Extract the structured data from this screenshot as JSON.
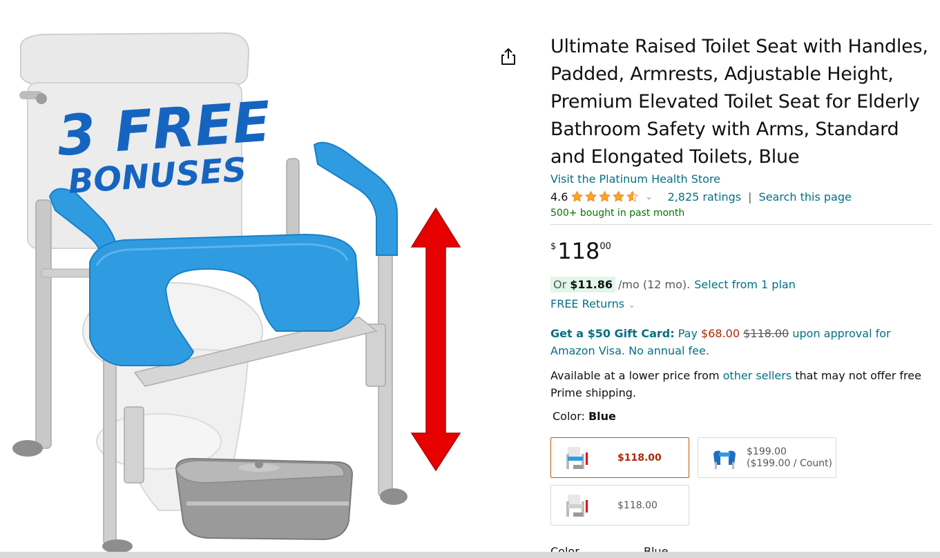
{
  "product": {
    "title": "Ultimate Raised Toilet Seat with Handles, Padded, Armrests, Adjustable Height, Premium Elevated Toilet Seat for Elderly Bathroom Safety with Arms, Standard and Elongated Toilets, Blue",
    "image_text_line1": "3 FREE",
    "image_text_line2": "BONUSES"
  },
  "store": {
    "link_text": "Visit the Platinum Health Store"
  },
  "rating": {
    "value": "4.6",
    "stars": 4.6,
    "ratings_count": "2,825 ratings",
    "separator": "|",
    "search_link": "Search this page"
  },
  "bought_text": "500+ bought in past month",
  "price": {
    "symbol": "$",
    "whole": "118",
    "fraction": "00"
  },
  "monthly": {
    "prefix": "Or",
    "amount": "$11.86",
    "suffix": "/mo (12 mo).",
    "link": "Select from 1 plan"
  },
  "returns": {
    "label": "FREE Returns"
  },
  "giftcard": {
    "title": "Get a $50 Gift Card:",
    "pay": "Pay",
    "new_price": "$68.00",
    "old_price": "$118.00",
    "rest": "upon approval for Amazon Visa. No annual fee."
  },
  "lower_price": {
    "prefix": "Available at a lower price from",
    "link": "other sellers",
    "suffix": "that may not offer free Prime shipping."
  },
  "color": {
    "label": "Color:",
    "value": "Blue"
  },
  "swatches": [
    {
      "price": "$118.00",
      "selected": true
    },
    {
      "price": "$199.00",
      "unit": "($199.00 / Count)",
      "selected": false
    },
    {
      "price": "$118.00",
      "selected": false
    }
  ],
  "cut_row": {
    "label": "Color",
    "value": "Blue"
  },
  "colors": {
    "link": "#007185",
    "price_red": "#b12704",
    "star": "#ffa41c",
    "seat_blue": "#2f9be0",
    "bonus_text": "#1565c0",
    "arrow_red": "#e60000",
    "selected_border": "#c45500"
  },
  "icons": {
    "share": "share-icon",
    "star": "star-icon",
    "dropdown": "chevron-down-icon"
  }
}
